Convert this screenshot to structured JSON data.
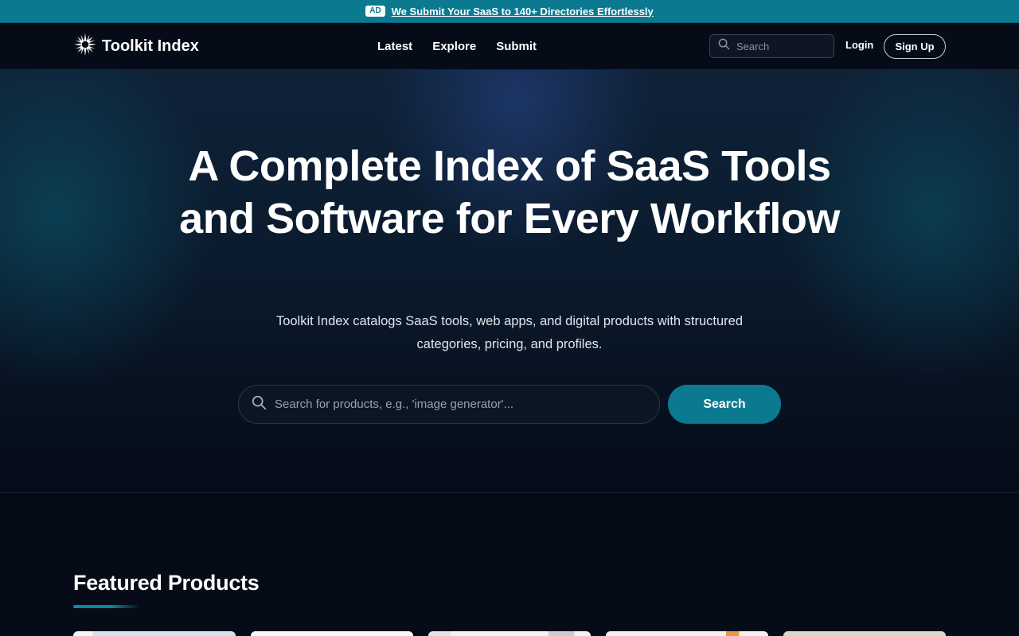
{
  "adbar": {
    "badge": "AD",
    "link_text": "We Submit Your SaaS to 140+ Directories Effortlessly"
  },
  "nav": {
    "brand": "Toolkit Index",
    "brand_icon": "starburst-logo-icon",
    "links": [
      "Latest",
      "Explore",
      "Submit"
    ],
    "search_placeholder": "Search",
    "login": "Login",
    "signup": "Sign Up"
  },
  "hero": {
    "title": "A Complete Index of SaaS Tools and Software for Every Workflow",
    "subtitle": "Toolkit Index catalogs SaaS tools, web apps, and digital products with structured categories, pricing, and profiles.",
    "search_placeholder": "Search for products, e.g., 'image generator'...",
    "search_button": "Search"
  },
  "featured": {
    "title": "Featured Products"
  },
  "colors": {
    "accent": "#0b7a91",
    "background": "#050b17",
    "ad_bar": "#0b7a91"
  }
}
